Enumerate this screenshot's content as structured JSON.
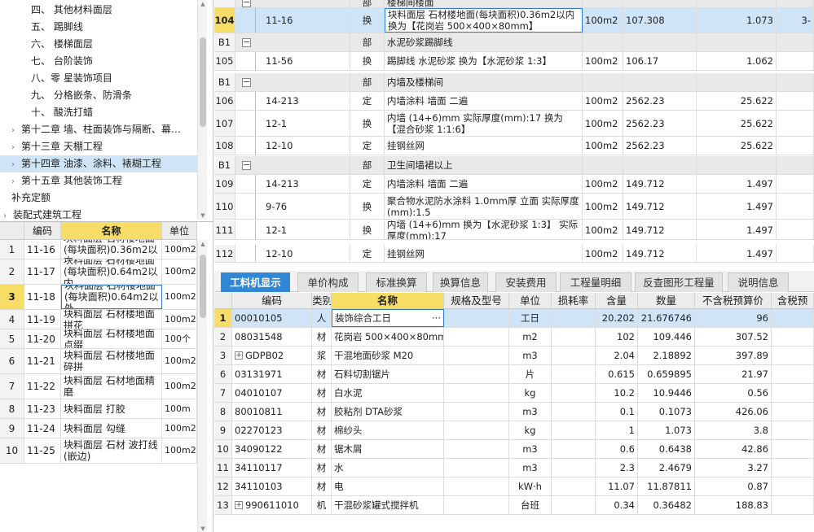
{
  "tree": {
    "items": [
      {
        "label": "四、 其他材料面层",
        "indent": 2
      },
      {
        "label": "五、 踢脚线",
        "indent": 2
      },
      {
        "label": "六、 楼梯面层",
        "indent": 2
      },
      {
        "label": "七、 台阶装饰",
        "indent": 2
      },
      {
        "label": "八、零 星装饰项目",
        "indent": 2
      },
      {
        "label": "九、 分格嵌条、防滑条",
        "indent": 2
      },
      {
        "label": "十、 酸洗打蜡",
        "indent": 2
      },
      {
        "label": "第十二章 墙、柱面装饰与隔断、幕…",
        "indent": 1,
        "arrow": true
      },
      {
        "label": "第十三章 天棚工程",
        "indent": 1,
        "arrow": true
      },
      {
        "label": "第十四章 油漆、涂料、裱糊工程",
        "indent": 1,
        "arrow": true,
        "selected": true
      },
      {
        "label": "第十五章 其他装饰工程",
        "indent": 1,
        "arrow": true
      },
      {
        "label": "补充定额",
        "indent": 1
      },
      {
        "label": "装配式建筑工程",
        "indent": 0,
        "arrow": true
      }
    ]
  },
  "quota": {
    "headers": [
      "编码",
      "名称",
      "单位"
    ],
    "rows": [
      {
        "n": "1",
        "code": "11-16",
        "name": "块料面层 石材楼地面(每块面积)0.36m2以内",
        "unit": "100m2"
      },
      {
        "n": "2",
        "code": "11-17",
        "name": "块料面层 石材楼地面(每块面积)0.64m2以内",
        "unit": "100m2"
      },
      {
        "n": "3",
        "code": "11-18",
        "name": "块料面层 石材楼地面(每块面积)0.64m2以外",
        "unit": "100m2",
        "selected": true
      },
      {
        "n": "4",
        "code": "11-19",
        "name": "块料面层 石材楼地面拼花",
        "unit": "100m2"
      },
      {
        "n": "5",
        "code": "11-20",
        "name": "块料面层 石材楼地面点缀",
        "unit": "100个"
      },
      {
        "n": "6",
        "code": "11-21",
        "name": "块料面层 石材楼地面碎拼",
        "unit": "100m2"
      },
      {
        "n": "7",
        "code": "11-22",
        "name": "块料面层 石材地面精磨",
        "unit": "100m2"
      },
      {
        "n": "8",
        "code": "11-23",
        "name": "块料面层 打胶",
        "unit": "100m"
      },
      {
        "n": "9",
        "code": "11-24",
        "name": "块料面层 勾缝",
        "unit": "100m2"
      },
      {
        "n": "10",
        "code": "11-25",
        "name": "块料面层 石材 波打线(嵌边)",
        "unit": "100m2"
      }
    ]
  },
  "budget": {
    "rows": [
      {
        "n": "",
        "code": "",
        "type": "部",
        "name": "楼梯间楼面",
        "unit": "",
        "qty": "",
        "amount": "",
        "extra": "",
        "kind": "sec"
      },
      {
        "n": "104",
        "code": "11-16",
        "type": "换",
        "name": "块料面层 石材楼地面(每块面积)0.36m2以内  换为【花岗岩 500×400×80mm】",
        "unit": "100m2",
        "qty": "107.308",
        "amount": "1.073",
        "extra": "3-",
        "kind": "sel"
      },
      {
        "n": "B1",
        "code": "",
        "type": "部",
        "name": "水泥砂浆踢脚线",
        "unit": "",
        "qty": "",
        "amount": "",
        "extra": "",
        "kind": "sec"
      },
      {
        "n": "105",
        "code": "11-56",
        "type": "换",
        "name": "踢脚线 水泥砂浆  换为【水泥砂浆 1:3】",
        "unit": "100m2",
        "qty": "106.17",
        "amount": "1.062",
        "extra": "",
        "kind": ""
      },
      {
        "n": "B1",
        "code": "",
        "type": "部",
        "name": "内墙及楼梯间",
        "unit": "",
        "qty": "",
        "amount": "",
        "extra": "",
        "kind": "sec"
      },
      {
        "n": "106",
        "code": "14-213",
        "type": "定",
        "name": "内墙涂料 墙面 二遍",
        "unit": "100m2",
        "qty": "2562.23",
        "amount": "25.622",
        "extra": "",
        "kind": ""
      },
      {
        "n": "107",
        "code": "12-1",
        "type": "换",
        "name": "内墙 (14+6)mm  实际厚度(mm):17  换为【混合砂浆 1:1:6】",
        "unit": "100m2",
        "qty": "2562.23",
        "amount": "25.622",
        "extra": "",
        "kind": ""
      },
      {
        "n": "108",
        "code": "12-10",
        "type": "定",
        "name": "挂钢丝网",
        "unit": "100m2",
        "qty": "2562.23",
        "amount": "25.622",
        "extra": "",
        "kind": ""
      },
      {
        "n": "B1",
        "code": "",
        "type": "部",
        "name": "卫生间墙裙以上",
        "unit": "",
        "qty": "",
        "amount": "",
        "extra": "",
        "kind": "sec"
      },
      {
        "n": "109",
        "code": "14-213",
        "type": "定",
        "name": "内墙涂料 墙面 二遍",
        "unit": "100m2",
        "qty": "149.712",
        "amount": "1.497",
        "extra": "",
        "kind": ""
      },
      {
        "n": "110",
        "code": "9-76",
        "type": "换",
        "name": "聚合物水泥防水涂料 1.0mm厚 立面  实际厚度(mm):1.5",
        "unit": "100m2",
        "qty": "149.712",
        "amount": "1.497",
        "extra": "",
        "kind": ""
      },
      {
        "n": "111",
        "code": "12-1",
        "type": "换",
        "name": "内墙 (14+6)mm  换为【水泥砂浆 1:3】  实际厚度(mm):17",
        "unit": "100m2",
        "qty": "149.712",
        "amount": "1.497",
        "extra": "",
        "kind": ""
      },
      {
        "n": "112",
        "code": "12-10",
        "type": "定",
        "name": "挂钢丝网",
        "unit": "100m2",
        "qty": "149.712",
        "amount": "1.497",
        "extra": "",
        "kind": ""
      }
    ]
  },
  "tabs": [
    "工料机显示",
    "单价构成",
    "标准换算",
    "换算信息",
    "安装费用",
    "工程量明细",
    "反查图形工程量",
    "说明信息"
  ],
  "detail": {
    "headers": [
      "编码",
      "类别",
      "名称",
      "规格及型号",
      "单位",
      "损耗率",
      "含量",
      "数量",
      "不含税预算价",
      "含税预"
    ],
    "rows": [
      {
        "n": "1",
        "code": "00010105",
        "cat": "人",
        "name": "装饰综合工日",
        "unit": "工日",
        "content": "20.202",
        "qty": "21.676746",
        "price": "96",
        "selected": true
      },
      {
        "n": "2",
        "code": "08031548",
        "cat": "材",
        "name": "花岗岩 500×400×80mm",
        "unit": "m2",
        "content": "102",
        "qty": "109.446",
        "price": "307.52"
      },
      {
        "n": "3",
        "code": "GDPB02",
        "cat": "浆",
        "name": "干混地面砂浆 M20",
        "unit": "m3",
        "content": "2.04",
        "qty": "2.18892",
        "price": "397.89",
        "plus": true
      },
      {
        "n": "6",
        "code": "03131971",
        "cat": "材",
        "name": "石料切割锯片",
        "unit": "片",
        "content": "0.615",
        "qty": "0.659895",
        "price": "21.97"
      },
      {
        "n": "7",
        "code": "04010107",
        "cat": "材",
        "name": "白水泥",
        "unit": "kg",
        "content": "10.2",
        "qty": "10.9446",
        "price": "0.56"
      },
      {
        "n": "8",
        "code": "80010811",
        "cat": "材",
        "name": "胶粘剂 DTA砂浆",
        "unit": "m3",
        "content": "0.1",
        "qty": "0.1073",
        "price": "426.06"
      },
      {
        "n": "9",
        "code": "02270123",
        "cat": "材",
        "name": "棉纱头",
        "unit": "kg",
        "content": "1",
        "qty": "1.073",
        "price": "3.8"
      },
      {
        "n": "10",
        "code": "34090122",
        "cat": "材",
        "name": "锯木屑",
        "unit": "m3",
        "content": "0.6",
        "qty": "0.6438",
        "price": "42.86"
      },
      {
        "n": "11",
        "code": "34110117",
        "cat": "材",
        "name": "水",
        "unit": "m3",
        "content": "2.3",
        "qty": "2.4679",
        "price": "3.27"
      },
      {
        "n": "12",
        "code": "34110103",
        "cat": "材",
        "name": "电",
        "unit": "kW·h",
        "content": "11.07",
        "qty": "11.87811",
        "price": "0.87"
      },
      {
        "n": "13",
        "code": "990611010",
        "cat": "机",
        "name": "干混砂浆罐式搅拌机",
        "unit": "台班",
        "content": "0.34",
        "qty": "0.36482",
        "price": "188.83",
        "plus": true
      }
    ]
  }
}
